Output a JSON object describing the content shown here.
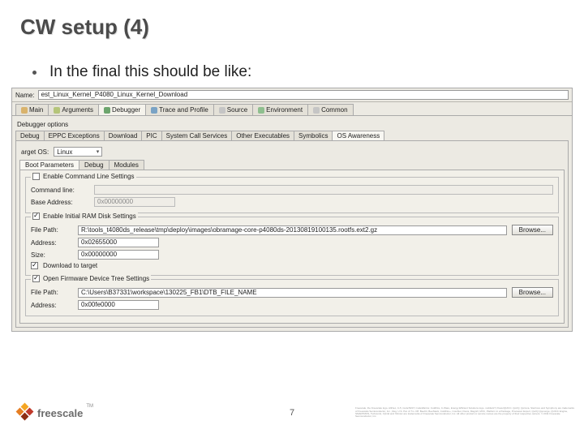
{
  "slide": {
    "title": "CW setup (4)",
    "bullet": "In the final this should be like:",
    "page_number": "7"
  },
  "window": {
    "name_label": "Name:",
    "name_value": "est_Linux_Kernel_P4080_Linux_Kernel_Download",
    "outer_tabs": {
      "main": "Main",
      "arguments": "Arguments",
      "debugger": "Debugger",
      "trace": "Trace and Profile",
      "source": "Source",
      "environment": "Environment",
      "common": "Common"
    },
    "debugger_options_label": "Debugger options",
    "secondary_tabs": {
      "debug": "Debug",
      "eppc": "EPPC Exceptions",
      "download": "Download",
      "pic": "PIC",
      "syscall": "System Call Services",
      "other": "Other Executables",
      "symbolics": "Symbolics",
      "os": "OS Awareness"
    },
    "target_os_label": "arget OS:",
    "target_os_value": "Linux",
    "inner_tabs": {
      "boot": "Boot Parameters",
      "debug": "Debug",
      "modules": "Modules"
    },
    "enable_cmd_label": "Enable Command Line Settings",
    "cmd_line_label": "Command line:",
    "cmd_line_value": "",
    "base_addr_label": "Base Address:",
    "base_addr_value": "0x00000000",
    "enable_ram_label": "Enable Initial RAM Disk Settings",
    "file_path_label": "File Path:",
    "file_path_value": "R:\\tools_t4080ds_release\\tmp\\deploy\\images\\obramage-core-p4080ds-20130819100135.rootfs.ext2.gz",
    "address_label": "Address:",
    "address_value": "0x02655000",
    "size_label": "Size:",
    "size_value": "0x00000000",
    "download_target_label": "Download to target",
    "open_fw_label": "Open Firmware Device Tree Settings",
    "fw_file_path_label": "File Path:",
    "fw_file_path_value": "C:\\Users\\B37331\\workspace\\130225_FB1\\DTB_FILE_NAME",
    "fw_address_label": "Address:",
    "fw_address_value": "0x00fe0000",
    "browse_label": "Browse..."
  },
  "footer": {
    "brand": "freescale",
    "tm": "TM",
    "legal": "Freescale, the Freescale logo, AltiVec, C-5, CodeTEST, CodeWarrior, ColdFire, C-Ware, Energy Efficient Solutions logo, mobileGT, PowerQUICC, QorIQ, Qorivva, StarCore and Symphony are trademarks of Freescale Semiconductor, Inc., Reg. U.S. Pat. & Tm. Off. BeeKit, BeeStack, ColdFire+, CoreNet, Flexis, MagniV, MXC, Platform in a Package, Processor Expert, QorIQ Qonverge, QUICC Engine, SMARTMOS, TurboLink, Vybrid and Xtrinsic are trademarks of Freescale Semiconductor, Inc. All other product or service names are the property of their respective owners. © 2011 Freescale Semiconductor, Inc."
  }
}
